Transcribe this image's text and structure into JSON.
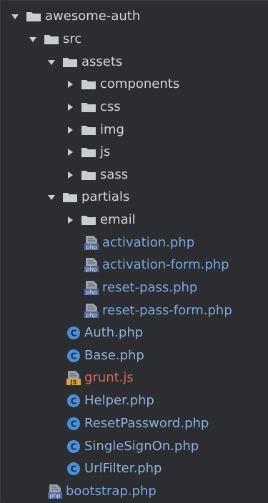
{
  "colors": {
    "background": "#2b2d31",
    "folder_text": "#d2d5da",
    "php_file_text": "#7aa8e0",
    "js_file_text": "#d66a5c",
    "class_icon": "#4a90d9",
    "folder_icon": "#c9ccd1"
  },
  "tree": {
    "root": {
      "label": "awesome-auth",
      "expanded": true,
      "icon": "folder-icon"
    },
    "src": {
      "label": "src",
      "expanded": true,
      "icon": "folder-icon"
    },
    "assets": {
      "label": "assets",
      "expanded": true,
      "icon": "folder-icon"
    },
    "components": {
      "label": "components",
      "expanded": false,
      "icon": "folder-icon"
    },
    "css": {
      "label": "css",
      "expanded": false,
      "icon": "folder-icon"
    },
    "img": {
      "label": "img",
      "expanded": false,
      "icon": "folder-icon"
    },
    "js": {
      "label": "js",
      "expanded": false,
      "icon": "folder-icon"
    },
    "sass": {
      "label": "sass",
      "expanded": false,
      "icon": "folder-icon"
    },
    "partials": {
      "label": "partials",
      "expanded": true,
      "icon": "folder-icon"
    },
    "email": {
      "label": "email",
      "expanded": false,
      "icon": "folder-icon"
    },
    "activation": {
      "label": "activation.php",
      "icon": "php-file-icon",
      "icon_text": "php"
    },
    "activation_form": {
      "label": "activation-form.php",
      "icon": "php-file-icon",
      "icon_text": "php"
    },
    "reset_pass": {
      "label": "reset-pass.php",
      "icon": "php-file-icon",
      "icon_text": "php"
    },
    "reset_pass_form": {
      "label": "reset-pass-form.php",
      "icon": "php-file-icon",
      "icon_text": "php"
    },
    "auth": {
      "label": "Auth.php",
      "icon": "class-file-icon",
      "icon_text": "C"
    },
    "base": {
      "label": "Base.php",
      "icon": "class-file-icon",
      "icon_text": "C"
    },
    "grunt": {
      "label": "grunt.js",
      "icon": "js-file-icon",
      "icon_text": "JS"
    },
    "helper": {
      "label": "Helper.php",
      "icon": "class-file-icon",
      "icon_text": "C"
    },
    "reset_password": {
      "label": "ResetPassword.php",
      "icon": "class-file-icon",
      "icon_text": "C"
    },
    "single_sign_on": {
      "label": "SingleSignOn.php",
      "icon": "class-file-icon",
      "icon_text": "C"
    },
    "url_filter": {
      "label": "UrlFilter.php",
      "icon": "class-file-icon",
      "icon_text": "C"
    },
    "bootstrap": {
      "label": "bootstrap.php",
      "icon": "php-file-icon",
      "icon_text": "php"
    }
  }
}
